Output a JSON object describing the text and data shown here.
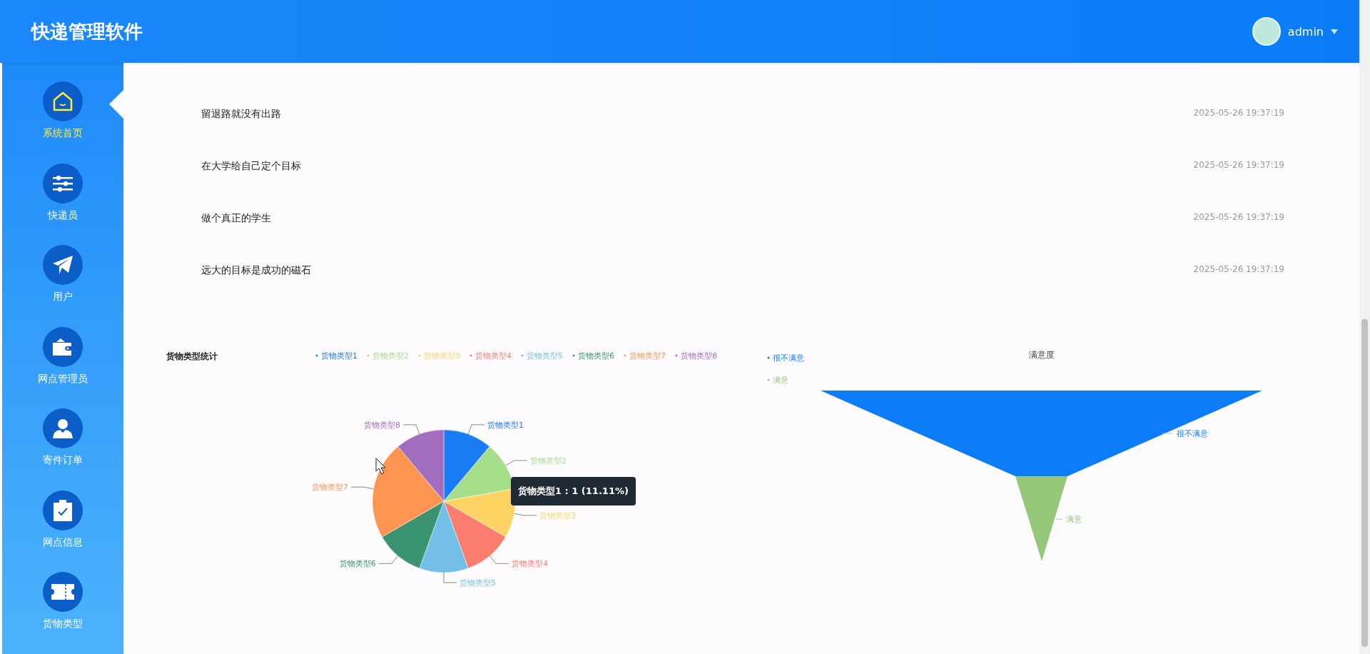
{
  "header": {
    "title": "快递管理软件",
    "user": "admin"
  },
  "sidebar": {
    "items": [
      {
        "label": "系统首页",
        "selected": true
      },
      {
        "label": "快递员",
        "selected": false
      },
      {
        "label": "用户",
        "selected": false
      },
      {
        "label": "网点管理员",
        "selected": false
      },
      {
        "label": "寄件订单",
        "selected": false
      },
      {
        "label": "网点信息",
        "selected": false
      },
      {
        "label": "货物类型",
        "selected": false
      }
    ]
  },
  "news": [
    {
      "title": "留退路就没有出路",
      "time": "2025-05-26 19:37:19"
    },
    {
      "title": "在大学给自己定个目标",
      "time": "2025-05-26 19:37:19"
    },
    {
      "title": "做个真正的学生",
      "time": "2025-05-26 19:37:19"
    },
    {
      "title": "远大的目标是成功的磁石",
      "time": "2025-05-26 19:37:19"
    }
  ],
  "goods_chart": {
    "legend": [
      {
        "label": "货物类型1",
        "color": "#1a7cf5"
      },
      {
        "label": "货物类型2",
        "color": "#a4de88"
      },
      {
        "label": "货物类型3",
        "color": "#fdd463"
      },
      {
        "label": "货物类型4",
        "color": "#fb7d6f"
      },
      {
        "label": "货物类型5",
        "color": "#74bfea"
      },
      {
        "label": "货物类型6",
        "color": "#3a9471"
      },
      {
        "label": "货物类型7",
        "color": "#fd9552"
      },
      {
        "label": "货物类型8",
        "color": "#a36dbf"
      }
    ],
    "chart_data": {
      "type": "pie",
      "title": "货物类型统计",
      "categories": [
        "货物类型1",
        "货物类型2",
        "货物类型3",
        "货物类型4",
        "货物类型5",
        "货物类型6",
        "货物类型7",
        "货物类型8"
      ],
      "values": [
        1,
        1,
        1,
        1,
        1,
        1,
        2,
        1
      ]
    },
    "tooltip": "货物类型1 : 1 (11.11%)"
  },
  "satisfaction_chart": {
    "title": "满意度",
    "legend": [
      {
        "label": "很不满意",
        "color": "#0d7df7"
      },
      {
        "label": "满意",
        "color": "#95c878"
      }
    ],
    "segments": [
      {
        "label": "很不满意",
        "color": "#0d7df7"
      },
      {
        "label": "满意",
        "color": "#95c878"
      }
    ]
  }
}
